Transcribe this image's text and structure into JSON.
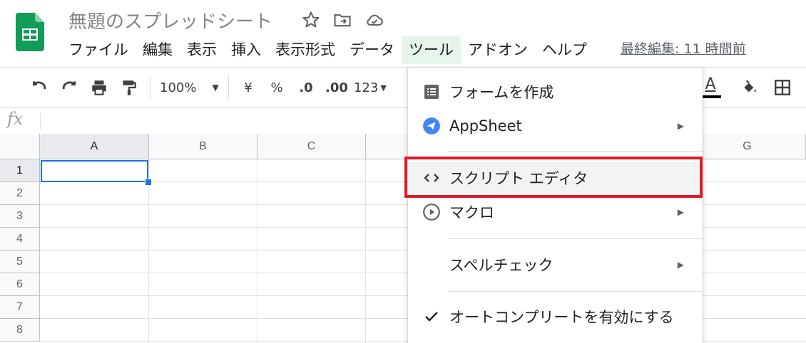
{
  "header": {
    "title": "無題のスプレッドシート",
    "last_edit": "最終編集: 11 時間前"
  },
  "menubar": {
    "items": [
      "ファイル",
      "編集",
      "表示",
      "挿入",
      "表示形式",
      "データ",
      "ツール",
      "アドオン",
      "ヘルプ"
    ],
    "active_index": 6
  },
  "toolbar": {
    "zoom": "100%",
    "currency": "¥",
    "percent": "%",
    "decrease_decimal": ".0",
    "increase_decimal": ".00",
    "more_formats": "123",
    "text_color_letter": "A"
  },
  "formula_bar": {
    "fx": "fx"
  },
  "grid": {
    "columns": [
      "A",
      "B",
      "C",
      "G"
    ],
    "rows": [
      "1",
      "2",
      "3",
      "4",
      "5",
      "6",
      "7",
      "8"
    ],
    "selected_cell": "A1"
  },
  "dropdown": {
    "items": [
      {
        "label": "フォームを作成",
        "icon": "form-icon",
        "submenu": false
      },
      {
        "label": "AppSheet",
        "icon": "appsheet-icon",
        "submenu": true
      },
      {
        "label": "スクリプト エディタ",
        "icon": "code-icon",
        "submenu": false,
        "highlighted": true
      },
      {
        "label": "マクロ",
        "icon": "play-circle-icon",
        "submenu": true
      },
      {
        "label": "スペルチェック",
        "icon": "",
        "submenu": true
      },
      {
        "label": "オートコンプリートを有効にする",
        "icon": "check-icon",
        "submenu": false
      }
    ]
  },
  "colors": {
    "accent": "#1a73e8",
    "highlight_box": "#e01b24",
    "sheets_green": "#0f9d58"
  }
}
